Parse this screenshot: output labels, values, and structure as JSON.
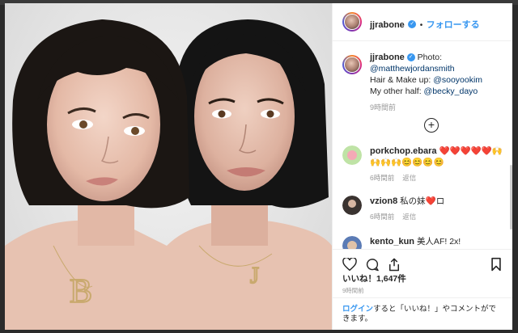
{
  "post": {
    "author": "jjrabone",
    "follow_label": "フォローする",
    "dot": "•",
    "caption": {
      "author": "jjrabone",
      "photo_label": "Photo:",
      "photographer": "@matthewjordansmith",
      "hair_label": "Hair & Make up:",
      "hair_artist": "@sooyookim",
      "other_label": "My other half:",
      "other_half": "@becky_dayo",
      "time": "9時間前"
    },
    "comments": [
      {
        "user": "porkchop.ebara",
        "text": "❤️❤️❤️❤️❤️🙌🙌🙌🙌😊😊😊😊",
        "time": "6時間前",
        "reply": "返信"
      },
      {
        "user": "vzion8",
        "text": "私の妹❤️ロ",
        "time": "6時間前",
        "reply": "返信"
      },
      {
        "user": "kento_kun",
        "text": "美人AF! 2x!"
      }
    ],
    "likes": "いいね！1,647件",
    "post_time": "9時間前",
    "login": {
      "link": "ログイン",
      "text": "すると「いいね！」やコメントができます。"
    },
    "photo": {
      "letter_left": "B",
      "letter_right": "J"
    }
  }
}
